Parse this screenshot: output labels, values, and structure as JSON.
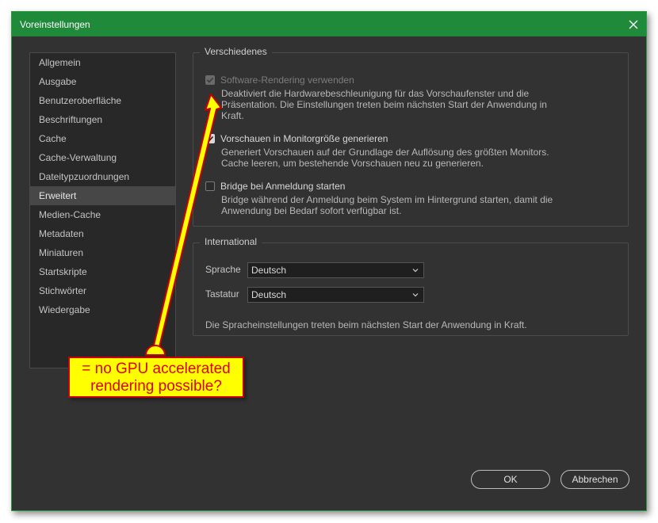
{
  "window": {
    "title": "Voreinstellungen"
  },
  "sidebar": {
    "items": [
      {
        "label": "Allgemein"
      },
      {
        "label": "Ausgabe"
      },
      {
        "label": "Benutzeroberfläche"
      },
      {
        "label": "Beschriftungen"
      },
      {
        "label": "Cache"
      },
      {
        "label": "Cache-Verwaltung"
      },
      {
        "label": "Dateitypzuordnungen"
      },
      {
        "label": "Erweitert"
      },
      {
        "label": "Medien-Cache"
      },
      {
        "label": "Metadaten"
      },
      {
        "label": "Miniaturen"
      },
      {
        "label": "Startskripte"
      },
      {
        "label": "Stichwörter"
      },
      {
        "label": "Wiedergabe"
      }
    ],
    "active": "Erweitert"
  },
  "misc": {
    "legend": "Verschiedenes",
    "options": [
      {
        "label": "Software-Rendering verwenden",
        "checked": true,
        "disabled": true,
        "desc_lines": [
          "Deaktiviert die Hardwarebeschleunigung für das Vorschaufenster und die",
          "Präsentation. Die Einstellungen treten beim nächsten Start der Anwendung in",
          "Kraft."
        ]
      },
      {
        "label": "Vorschauen in Monitorgröße generieren",
        "checked": true,
        "disabled": false,
        "desc_lines": [
          "Generiert Vorschauen auf der Grundlage der Auflösung des größten Monitors.",
          "Cache leeren, um bestehende Vorschauen neu zu generieren."
        ]
      },
      {
        "label": "Bridge bei Anmeldung starten",
        "checked": false,
        "disabled": false,
        "desc_lines": [
          "Bridge während der Anmeldung beim System im Hintergrund starten, damit die",
          "Anwendung bei Bedarf sofort verfügbar ist."
        ]
      }
    ]
  },
  "international": {
    "legend": "International",
    "language_label": "Sprache",
    "language_value": "Deutsch",
    "keyboard_label": "Tastatur",
    "keyboard_value": "Deutsch",
    "note": "Die Spracheinstellungen treten beim nächsten Start der Anwendung in Kraft."
  },
  "buttons": {
    "ok": "OK",
    "cancel": "Abbrechen"
  },
  "annotation": {
    "lines": [
      "= no GPU accelerated",
      "rendering possible?"
    ],
    "fill": "#ffff00",
    "stroke": "#c80000",
    "text_color": "#e00000"
  },
  "colors": {
    "titlebar": "#1f8a3a",
    "dialog_bg": "#323232",
    "active_item": "#474747"
  }
}
